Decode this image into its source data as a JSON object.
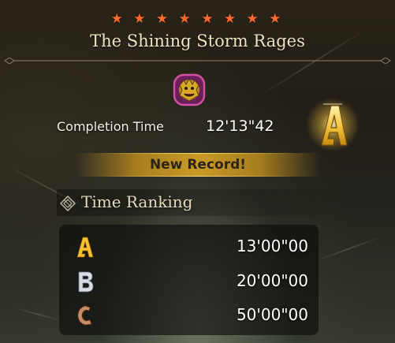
{
  "quest": {
    "stars": [
      "★",
      "★",
      "★",
      "★",
      "★",
      "★",
      "★",
      "★"
    ],
    "title": "The Shining Storm Rages",
    "monster_icon": "lion-monster-icon"
  },
  "result": {
    "completion_label": "Completion Time",
    "completion_time": "12'13\"42",
    "rank": "A",
    "new_record_label": "New Record!"
  },
  "ranking": {
    "title": "Time Ranking",
    "rows": [
      {
        "rank": "A",
        "time": "13'00\"00"
      },
      {
        "rank": "B",
        "time": "20'00\"00"
      },
      {
        "rank": "C",
        "time": "50'00\"00"
      }
    ]
  },
  "colors": {
    "star": "#ff6a2c",
    "gold": "#f2c23a",
    "rank_a": "#f6c232",
    "rank_b": "#d8dde4",
    "rank_c": "#c98a6a"
  }
}
